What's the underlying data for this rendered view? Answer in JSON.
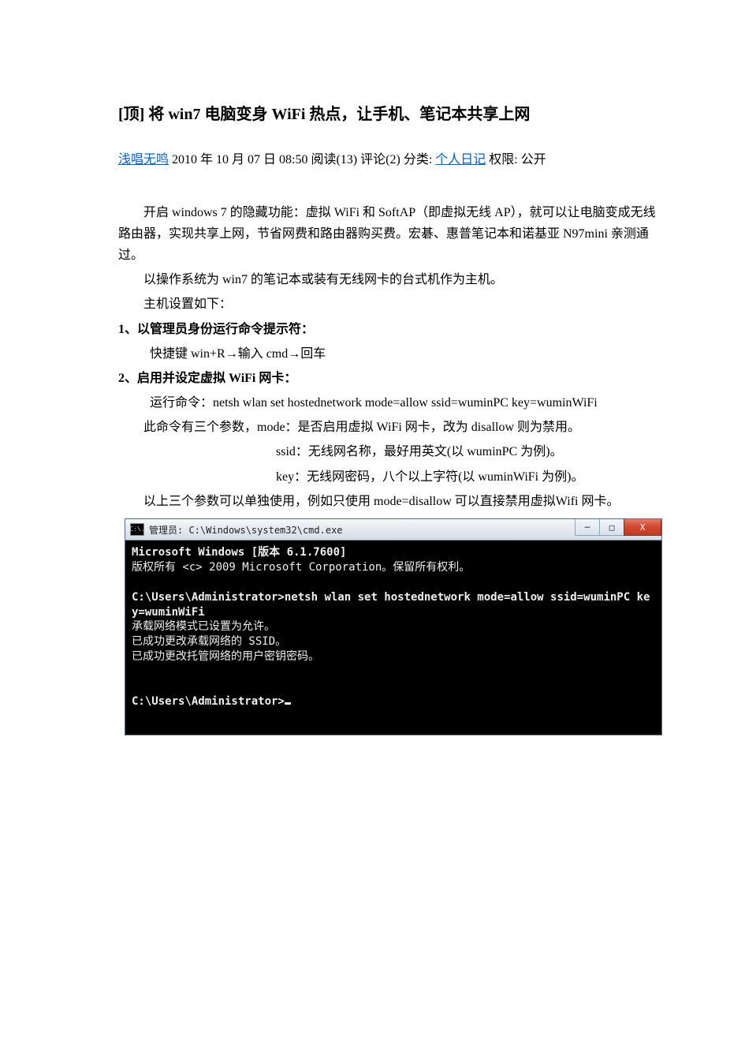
{
  "title": "[顶] 将 win7 电脑变身 WiFi 热点，让手机、笔记本共享上网",
  "meta": {
    "author": "浅唱无鸣",
    "date_time": "2010 年 10 月 07 日 08:50",
    "reads": "阅读(13)",
    "comments": "评论(2)",
    "cat_label": "分类:",
    "category": "个人日记",
    "perm": "权限: 公开"
  },
  "paras": {
    "p1": "开启 windows 7 的隐藏功能：虚拟 WiFi 和 SoftAP（即虚拟无线 AP），就可以让电脑变成无线路由器，实现共享上网，节省网费和路由器购买费。宏碁、惠普笔记本和诺基亚 N97mini 亲测通过。",
    "p2": "以操作系统为 win7 的笔记本或装有无线网卡的台式机作为主机。",
    "p3": "主机设置如下：",
    "step1_h": "1、以管理员身份运行命令提示符：",
    "step1_b": "快捷键 win+R→输入 cmd→回车",
    "step2_h": "2、启用并设定虚拟 WiFi 网卡：",
    "step2_cmd": "运行命令：netsh wlan set hostednetwork mode=allow ssid=wuminPC key=wuminWiFi",
    "step2_desc": "此命令有三个参数，mode：是否启用虚拟 WiFi 网卡，改为 disallow 则为禁用。",
    "ssid_line": "ssid：无线网名称，最好用英文(以 wuminPC 为例)。",
    "key_line": "key：无线网密码，八个以上字符(以 wuminWiFi 为例)。",
    "step2_end": "以上三个参数可以单独使用，例如只使用 mode=disallow 可以直接禁用虚拟Wifi 网卡。"
  },
  "cmd": {
    "icon_text": "C:\\.",
    "title": "管理员: C:\\Windows\\system32\\cmd.exe",
    "btn_min": "─",
    "btn_max": "□",
    "btn_close": "X",
    "line1": "Microsoft Windows [版本 6.1.7600]",
    "line2": "版权所有 <c> 2009 Microsoft Corporation。保留所有权利。",
    "prompt1": "C:\\Users\\Administrator>",
    "command": "netsh wlan set hostednetwork mode=allow ssid=wuminPC key=wuminWiFi",
    "out1": "承载网络模式已设置为允许。",
    "out2": "已成功更改承载网络的 SSID。",
    "out3": "已成功更改托管网络的用户密钥密码。",
    "prompt2": "C:\\Users\\Administrator>"
  }
}
